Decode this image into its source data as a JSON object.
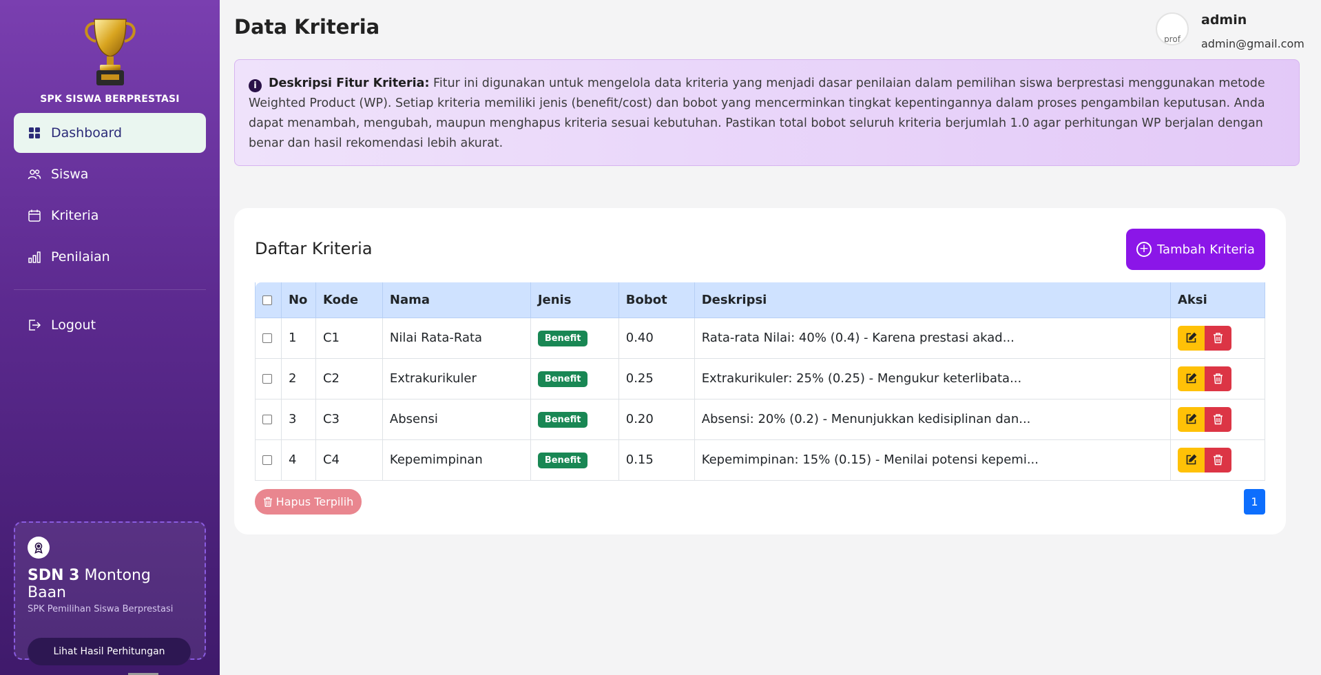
{
  "sidebar": {
    "brand_name": "SPK SISWA BERPRESTASI",
    "items": [
      {
        "label": "Dashboard",
        "icon": "grid-icon"
      },
      {
        "label": "Siswa",
        "icon": "users-icon"
      },
      {
        "label": "Kriteria",
        "icon": "calendar-icon"
      },
      {
        "label": "Penilaian",
        "icon": "bar-chart-icon"
      }
    ],
    "logout_label": "Logout",
    "school": {
      "name_bold": "SDN 3",
      "name_rest": " Montong Baan",
      "subtitle": "SPK Pemilihan Siswa Berprestasi",
      "button_label": "Lihat Hasil Perhitungan"
    }
  },
  "header": {
    "title": "Data Kriteria",
    "user_name": "admin",
    "user_email": "admin@gmail.com",
    "avatar_alt": "prof"
  },
  "info": {
    "label": "Deskripsi Fitur Kriteria:",
    "text": " Fitur ini digunakan untuk mengelola data kriteria yang menjadi dasar penilaian dalam pemilihan siswa berprestasi menggunakan metode Weighted Product (WP). Setiap kriteria memiliki jenis (benefit/cost) dan bobot yang mencerminkan tingkat kepentingannya dalam proses pengambilan keputusan. Anda dapat menambah, mengubah, maupun menghapus kriteria sesuai kebutuhan. Pastikan total bobot seluruh kriteria berjumlah 1.0 agar perhitungan WP berjalan dengan benar dan hasil rekomendasi lebih akurat."
  },
  "card": {
    "title": "Daftar Kriteria",
    "add_label": "Tambah Kriteria",
    "delete_selected_label": "Hapus Terpilih",
    "page": "1"
  },
  "table": {
    "headers": [
      "No",
      "Kode",
      "Nama",
      "Jenis",
      "Bobot",
      "Deskripsi",
      "Aksi"
    ],
    "rows": [
      {
        "no": "1",
        "kode": "C1",
        "nama": "Nilai Rata-Rata",
        "jenis": "Benefit",
        "bobot": "0.40",
        "deskripsi": "Rata-rata Nilai: 40% (0.4) - Karena prestasi akad..."
      },
      {
        "no": "2",
        "kode": "C2",
        "nama": "Extrakurikuler",
        "jenis": "Benefit",
        "bobot": "0.25",
        "deskripsi": "Extrakurikuler: 25% (0.25) - Mengukur keterlibata..."
      },
      {
        "no": "3",
        "kode": "C3",
        "nama": "Absensi",
        "jenis": "Benefit",
        "bobot": "0.20",
        "deskripsi": "Absensi: 20% (0.2) - Menunjukkan kedisiplinan dan..."
      },
      {
        "no": "4",
        "kode": "C4",
        "nama": "Kepemimpinan",
        "jenis": "Benefit",
        "bobot": "0.15",
        "deskripsi": "Kepemimpinan: 15% (0.15) - Menilai potensi kepemi..."
      }
    ]
  },
  "colors": {
    "sidebar_top": "#7a3fb0",
    "sidebar_bottom": "#3f1a6b",
    "accent": "#8b16e8",
    "benefit_badge": "#198754",
    "edit": "#ffc107",
    "delete": "#dc3545",
    "page_active": "#0d6efd"
  }
}
